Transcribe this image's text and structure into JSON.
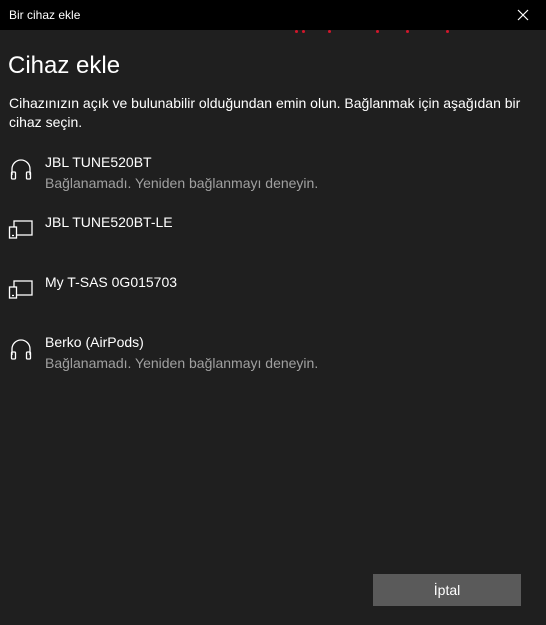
{
  "window": {
    "title": "Bir cihaz ekle",
    "close_icon": "close-icon"
  },
  "page": {
    "heading": "Cihaz ekle",
    "instructions": "Cihazınızın açık ve bulunabilir olduğundan emin olun. Bağlanmak için aşağıdan bir cihaz seçin."
  },
  "devices": [
    {
      "name": "JBL TUNE520BT",
      "status": "Bağlanamadı. Yeniden bağlanmayı deneyin.",
      "icon": "headphones-icon"
    },
    {
      "name": "JBL TUNE520BT-LE",
      "status": "",
      "icon": "devices-icon"
    },
    {
      "name": "My T-SAS 0G015703",
      "status": "",
      "icon": "devices-icon"
    },
    {
      "name": "Berko (AirPods)",
      "status": "Bağlanamadı. Yeniden bağlanmayı deneyin.",
      "icon": "headphones-icon"
    }
  ],
  "footer": {
    "cancel_label": "İptal"
  },
  "colors": {
    "titlebar": "#000000",
    "background": "#1f1f1f",
    "progress_accent": "#d1172b",
    "secondary_text": "#a0a0a0",
    "button": "#5a5a5a"
  }
}
